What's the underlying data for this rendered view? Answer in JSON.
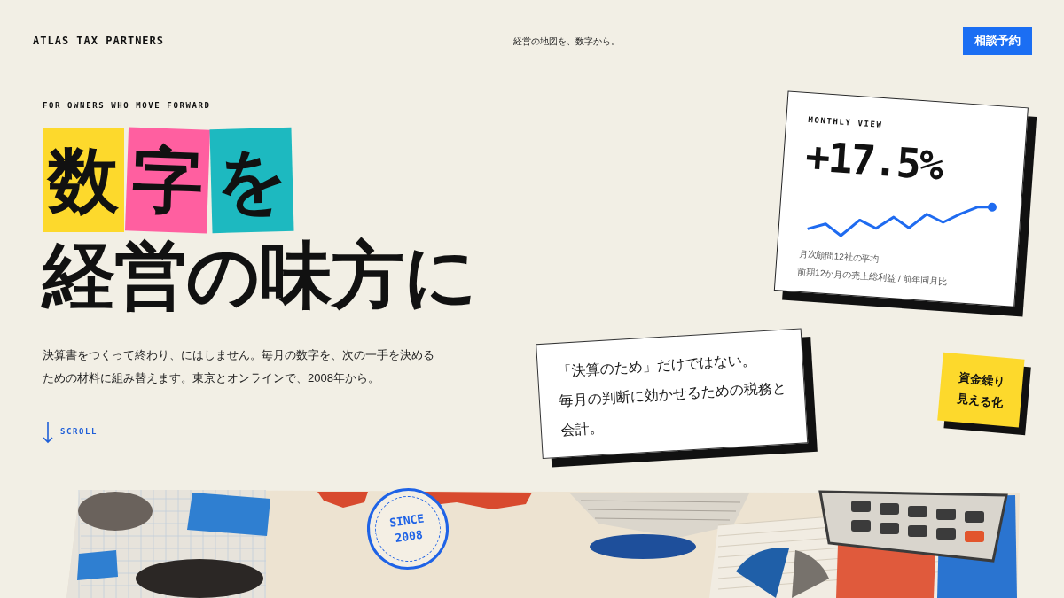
{
  "header": {
    "logo": "ATLAS TAX PARTNERS",
    "tagline": "経営の地図を、数字から。",
    "cta": "相談予約"
  },
  "hero": {
    "eyebrow": "FOR OWNERS WHO MOVE FORWARD",
    "tiles": [
      {
        "text": "数",
        "color": "#fdd92c"
      },
      {
        "text": "字",
        "color": "#ff5fa0"
      },
      {
        "text": "を",
        "color": "#1db9c0"
      }
    ],
    "headline_line_2": "経営の味方に",
    "lead": "決算書をつくって終わり、にはしません。毎月の数字を、次の一手を決めるための材料に組み替えます。東京とオンラインで、2008年から。",
    "scroll": "SCROLL"
  },
  "monthly_card": {
    "eyebrow": "MONTHLY VIEW",
    "value": "+17.5%",
    "notes": [
      "月次顧問12社の平均",
      "前期12か月の売上総利益 / 前年同月比"
    ]
  },
  "quote_card": {
    "text": "「決算のため」だけではない。毎月の判断に効かせるための税務と会計。"
  },
  "sticky_note": {
    "text": "資金繰り見える化"
  },
  "collage": {
    "badge": {
      "label": "SINCE",
      "year": "2008"
    }
  }
}
